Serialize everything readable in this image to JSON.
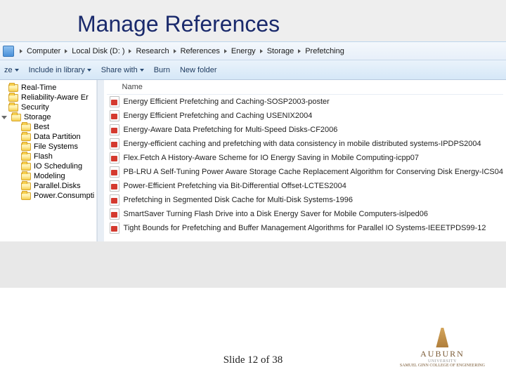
{
  "slide": {
    "title": "Manage References",
    "footer": "Slide 12 of 38"
  },
  "breadcrumb": {
    "items": [
      "Computer",
      "Local Disk (D: )",
      "Research",
      "References",
      "Energy",
      "Storage",
      "Prefetching"
    ]
  },
  "toolbar": {
    "organize": "ze",
    "include": "Include in library",
    "share": "Share with",
    "burn": "Burn",
    "newfolder": "New folder"
  },
  "columns": {
    "name": "Name"
  },
  "tree": {
    "items": [
      {
        "label": "Real-Time",
        "indent": 0,
        "expander": ""
      },
      {
        "label": "Reliability-Aware Er",
        "indent": 0,
        "expander": ""
      },
      {
        "label": "Security",
        "indent": 0,
        "expander": ""
      },
      {
        "label": "Storage",
        "indent": 0,
        "expander": "open"
      },
      {
        "label": "Best",
        "indent": 1,
        "expander": ""
      },
      {
        "label": "Data Partition",
        "indent": 1,
        "expander": ""
      },
      {
        "label": "File Systems",
        "indent": 1,
        "expander": ""
      },
      {
        "label": "Flash",
        "indent": 1,
        "expander": ""
      },
      {
        "label": "IO Scheduling",
        "indent": 1,
        "expander": ""
      },
      {
        "label": "Modeling",
        "indent": 1,
        "expander": ""
      },
      {
        "label": "Parallel.Disks",
        "indent": 1,
        "expander": ""
      },
      {
        "label": "Power.Consumpti",
        "indent": 1,
        "expander": ""
      }
    ]
  },
  "files": [
    {
      "name": "Energy Efficient Prefetching and Caching-SOSP2003-poster"
    },
    {
      "name": "Energy Efficient Prefetching and Caching  USENIX2004"
    },
    {
      "name": "Energy-Aware Data Prefetching for Multi-Speed Disks-CF2006"
    },
    {
      "name": "Energy-efficient caching and prefetching with data consistency in mobile distributed systems-IPDPS2004"
    },
    {
      "name": "Flex.Fetch A History-Aware Scheme for IO Energy Saving in Mobile Computing-icpp07"
    },
    {
      "name": "PB-LRU A Self-Tuning Power Aware Storage Cache Replacement Algorithm for Conserving Disk Energy-ICS04"
    },
    {
      "name": "Power-Efficient Prefetching via Bit-Differential Offset-LCTES2004"
    },
    {
      "name": "Prefetching in Segmented Disk Cache for Multi-Disk Systems-1996"
    },
    {
      "name": "SmartSaver Turning Flash Drive into a Disk Energy Saver for Mobile Computers-islped06"
    },
    {
      "name": "Tight Bounds for Prefetching and Buffer Management Algorithms for Parallel IO Systems-IEEETPDS99-12"
    }
  ],
  "logo": {
    "name": "AUBURN",
    "sub1": "UNIVERSITY",
    "sub2": "SAMUEL GINN COLLEGE OF ENGINEERING"
  }
}
